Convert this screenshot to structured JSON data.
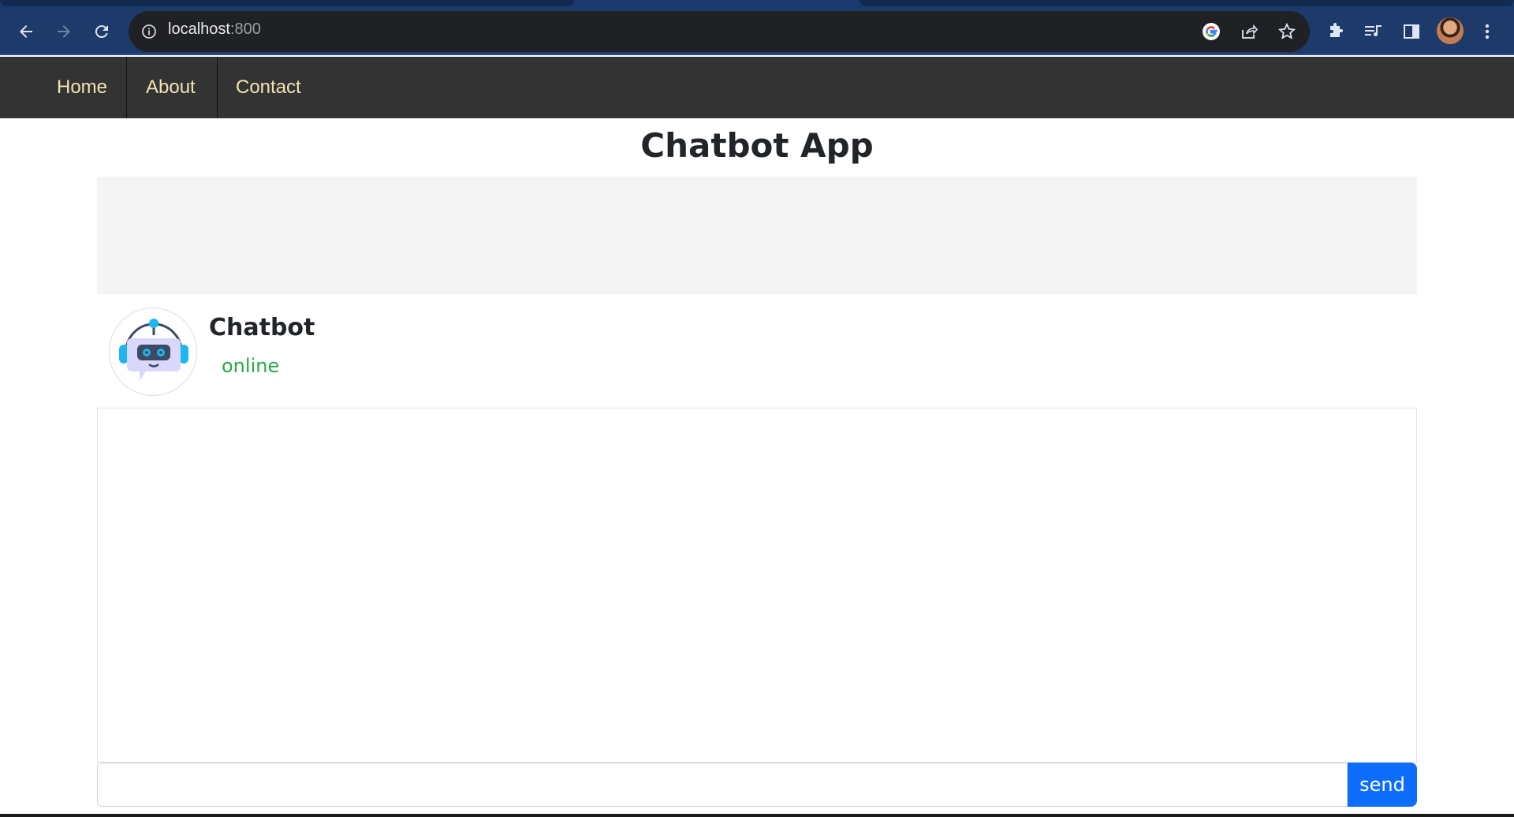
{
  "browser": {
    "url_host": "localhost",
    "url_port": ":800"
  },
  "site_nav": {
    "items": [
      {
        "label": "Home"
      },
      {
        "label": "About"
      },
      {
        "label": "Contact"
      }
    ]
  },
  "page": {
    "title": "Chatbot App"
  },
  "bot": {
    "name": "Chatbot",
    "status": "online",
    "status_color": "#28a745"
  },
  "composer": {
    "input_value": "",
    "send_label": "send",
    "send_color": "#0d6efd"
  }
}
